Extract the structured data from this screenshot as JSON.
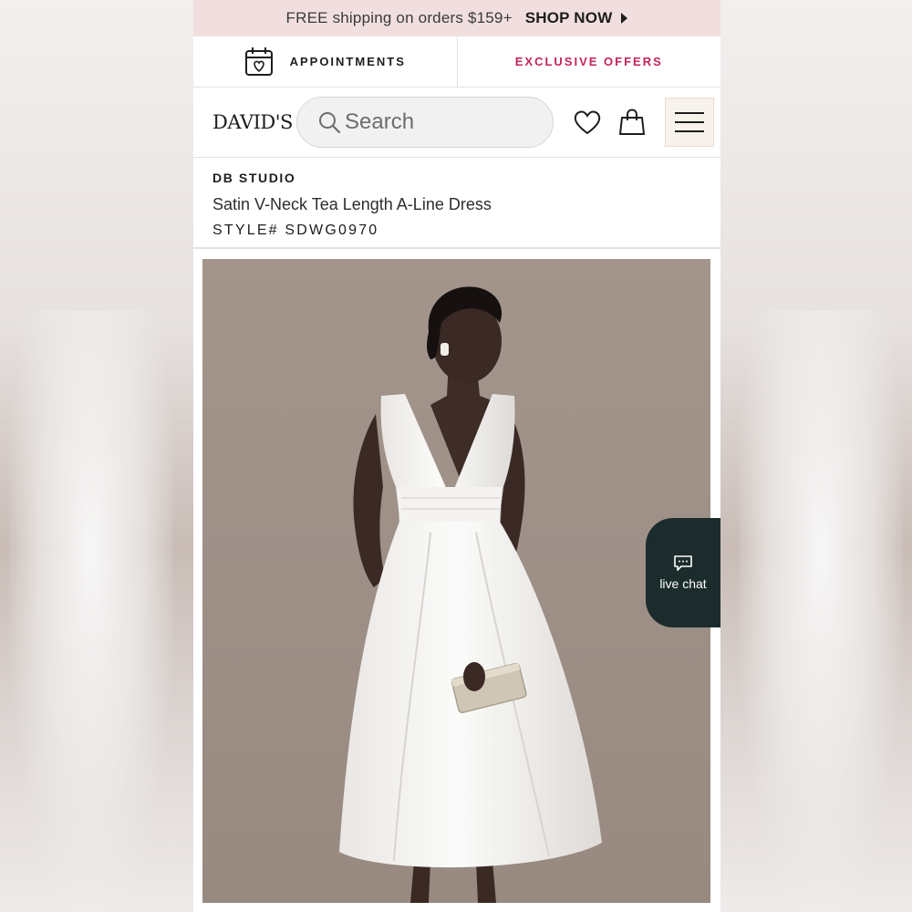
{
  "promo": {
    "text": "FREE shipping on orders $159+",
    "cta": "SHOP NOW"
  },
  "nav": {
    "appointments": "APPOINTMENTS",
    "offers": "EXCLUSIVE OFFERS"
  },
  "header": {
    "logo": "DAVID'S",
    "search_placeholder": "Search"
  },
  "product": {
    "brand": "DB STUDIO",
    "name": "Satin V-Neck Tea Length A-Line Dress",
    "style": "STYLE# SDWG0970"
  },
  "chat": {
    "label": "live chat"
  },
  "colors": {
    "promo_bg": "#f1dfe0",
    "offers_accent": "#c4245a",
    "chat_bg": "#1c2c2c",
    "menu_bg": "#f8f2ec"
  },
  "icons": [
    "calendar-heart-icon",
    "search-icon",
    "heart-icon",
    "shopping-bag-icon",
    "hamburger-menu-icon",
    "chat-bubble-icon",
    "play-caret-icon"
  ]
}
